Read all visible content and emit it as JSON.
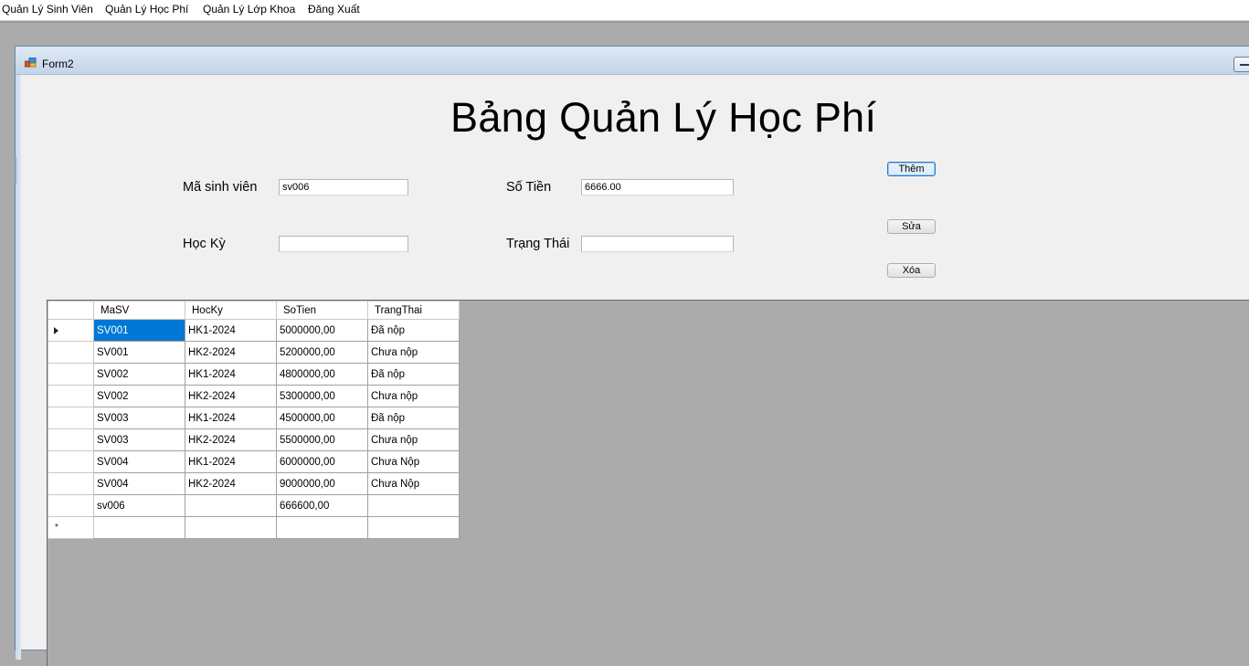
{
  "menu": {
    "items": [
      "Quản Lý Sinh Viên",
      "Quản Lý Học Phí",
      "Quản Lý Lớp Khoa",
      "Đăng Xuất"
    ]
  },
  "window": {
    "title": "Form2",
    "icon": "form-icon"
  },
  "form": {
    "heading": "Bảng Quản Lý Học Phí",
    "labels": {
      "masv": "Mã sinh viên",
      "hocky": "Học Kỳ",
      "sotien": "Số Tiền",
      "trangthai": "Trạng Thái"
    },
    "inputs": {
      "masv": "sv006",
      "hocky": "",
      "sotien": "6666.00",
      "trangthai": ""
    },
    "buttons": {
      "them": "Thêm",
      "sua": "Sửa",
      "xoa": "Xóa"
    }
  },
  "grid": {
    "columns": [
      "MaSV",
      "HocKy",
      "SoTien",
      "TrangThai"
    ],
    "rows": [
      [
        "SV001",
        "HK1-2024",
        "5000000,00",
        "Đã nộp"
      ],
      [
        "SV001",
        "HK2-2024",
        "5200000,00",
        "Chưa nộp"
      ],
      [
        "SV002",
        "HK1-2024",
        "4800000,00",
        "Đã nộp"
      ],
      [
        "SV002",
        "HK2-2024",
        "5300000,00",
        "Chưa nộp"
      ],
      [
        "SV003",
        "HK1-2024",
        "4500000,00",
        "Đã nộp"
      ],
      [
        "SV003",
        "HK2-2024",
        "5500000,00",
        "Chưa nộp"
      ],
      [
        "SV004",
        "HK1-2024",
        "6000000,00",
        "Chưa Nộp"
      ],
      [
        "SV004",
        "HK2-2024",
        "9000000,00",
        "Chưa Nộp"
      ],
      [
        "sv006",
        "",
        "666600,00",
        ""
      ]
    ],
    "new_row_marker": "*",
    "colors": {
      "selection": "#0078d7",
      "background": "#ababab"
    }
  }
}
